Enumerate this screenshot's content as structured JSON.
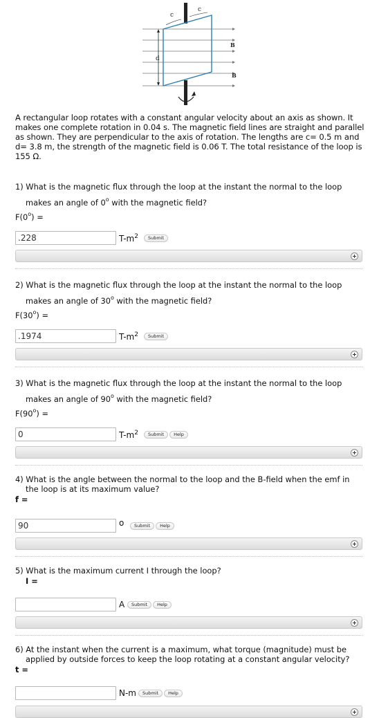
{
  "figure": {
    "label_c1": "c",
    "label_c2": "c",
    "label_d": "d",
    "label_b1": "B",
    "label_b2": "B"
  },
  "intro": "A rectangular loop rotates with a constant angular velocity about an axis as shown. It makes one complete rotation in 0.04 s. The magnetic field lines are straight and parallel as shown. They are perpendicular to the axis of rotation. The lengths are c= 0.5 m and d= 3.8 m, the strength of the magnetic field is 0.06 T. The total resistance of the loop is 155 Ω.",
  "questions": [
    {
      "line1": "1) What is the magnetic flux through the loop at the instant the normal to the loop",
      "line2_pre": "makes an angle of 0",
      "sup": "o",
      "line2_post": " with the magnetic field?",
      "var_pre": "F(0",
      "var_post": ") =",
      "value": ".228",
      "unit": "T-m",
      "unit_sup": "2",
      "submit": "Submit"
    },
    {
      "line1": "2) What is the magnetic flux through the loop at the instant the normal to the loop",
      "line2_pre": "makes an angle of 30",
      "sup": "o",
      "line2_post": " with the magnetic field?",
      "var_pre": "F(30",
      "var_post": ") =",
      "value": ".1974",
      "unit": "T-m",
      "unit_sup": "2",
      "submit": "Submit"
    },
    {
      "line1": "3) What is the magnetic flux through the loop at the instant the normal to the loop",
      "line2_pre": "makes an angle of 90",
      "sup": "o",
      "line2_post": " with the magnetic field?",
      "var_pre": "F(90",
      "var_post": ") =",
      "value": "0",
      "unit": "T-m",
      "unit_sup": "2",
      "submit": "Submit",
      "help": "Help"
    },
    {
      "line1": "4) What is the angle between the normal to the loop and the B-field when the emf in",
      "line2": "the loop is at its maximum value?",
      "var": "f =",
      "value": "90",
      "unit": "o",
      "submit": "Submit",
      "help": "Help"
    },
    {
      "line1": "5) What is the maximum current I through the loop?",
      "var": "I =",
      "value": "",
      "unit": "A",
      "submit": "Submit",
      "help": "Help"
    },
    {
      "line1": "6) At the instant when the current is a maximum, what torque (magnitude) must be",
      "line2": "applied by outside forces to keep the loop rotating at a constant angular velocity?",
      "var": "t =",
      "value": "",
      "unit": "N-m",
      "submit": "Submit",
      "help": "Help"
    }
  ]
}
